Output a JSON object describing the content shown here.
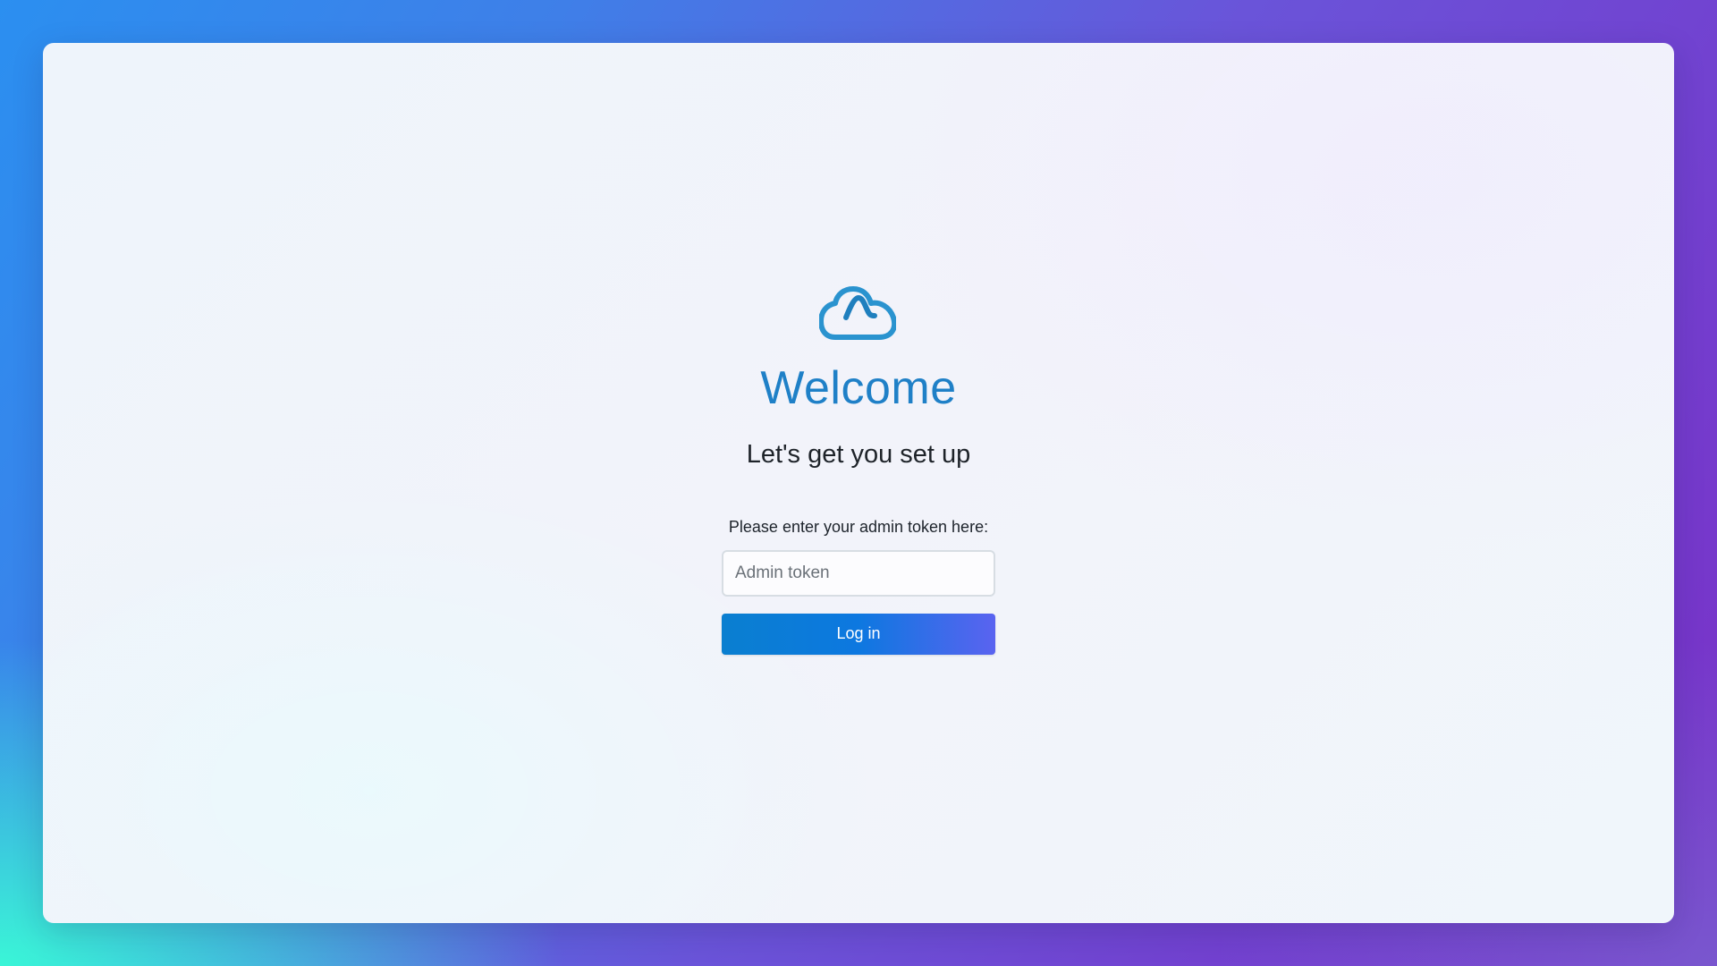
{
  "icons": {
    "logo": "cloud-logo-icon"
  },
  "colors": {
    "accent": "#1f80c7",
    "button_gradient_start": "#0a7fd0",
    "button_gradient_end": "#5a63f0"
  },
  "welcome": {
    "title": "Welcome",
    "subtitle": "Let's get you set up"
  },
  "form": {
    "prompt": "Please enter your admin token here:",
    "token_placeholder": "Admin token",
    "token_value": "",
    "login_label": "Log in"
  }
}
